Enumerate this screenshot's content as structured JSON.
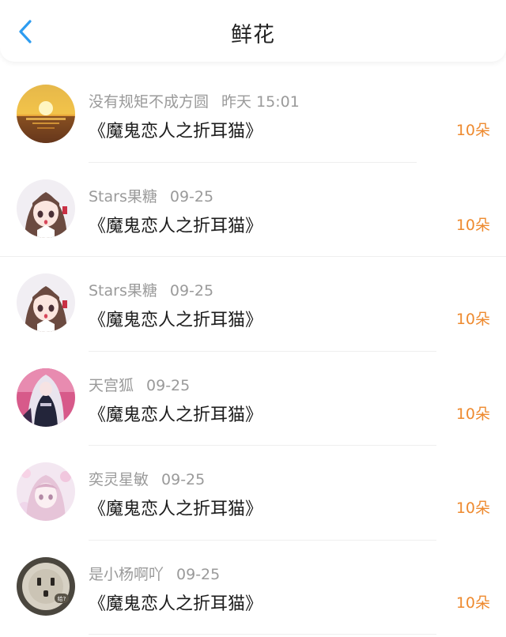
{
  "header": {
    "title": "鲜花",
    "back_icon": "chevron-left-icon",
    "accent": "#2d9cf0"
  },
  "colors": {
    "amount": "#ee8a2f",
    "meta": "#9a9a9a"
  },
  "items": [
    {
      "user": "没有规矩不成方圆",
      "time": "昨天 15:01",
      "book": "《魔鬼恋人之折耳猫》",
      "amount": "10朵",
      "avatar": "sunset-avatar"
    },
    {
      "user": "Stars果糖",
      "time": "09-25",
      "book": "《魔鬼恋人之折耳猫》",
      "amount": "10朵",
      "avatar": "anime-girl-avatar"
    },
    {
      "user": "Stars果糖",
      "time": "09-25",
      "book": "《魔鬼恋人之折耳猫》",
      "amount": "10朵",
      "avatar": "anime-girl-avatar"
    },
    {
      "user": "天宫狐",
      "time": "09-25",
      "book": "《魔鬼恋人之折耳猫》",
      "amount": "10朵",
      "avatar": "hooded-character-avatar"
    },
    {
      "user": "奕灵星敏",
      "time": "09-25",
      "book": "《魔鬼恋人之折耳猫》",
      "amount": "10朵",
      "avatar": "pastel-girl-avatar"
    },
    {
      "user": "是小杨啊吖",
      "time": "09-25",
      "book": "《魔鬼恋人之折耳猫》",
      "amount": "10朵",
      "avatar": "socket-avatar",
      "avatar_text": "给?"
    }
  ]
}
